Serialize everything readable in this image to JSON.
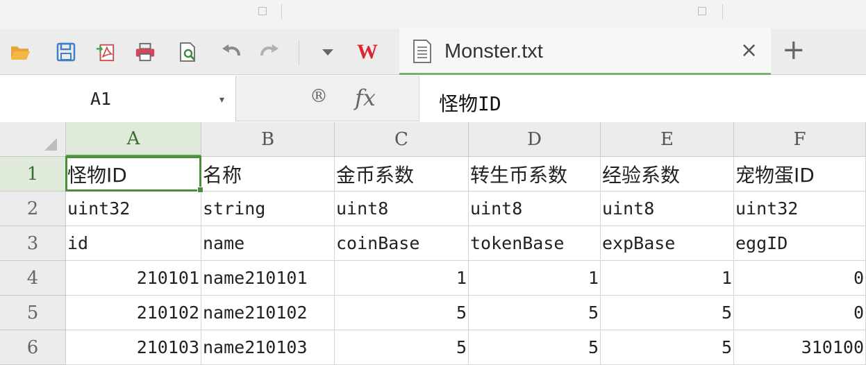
{
  "app": {
    "accent_color": "#5f9d4f"
  },
  "toolbar": {
    "icons": [
      "open-folder-icon",
      "save-icon",
      "export-pdf-icon",
      "print-icon",
      "print-preview-icon",
      "undo-icon",
      "redo-icon",
      "dropdown-arrow-icon",
      "wps-logo-icon"
    ],
    "wps_logo": "W"
  },
  "tab": {
    "title": "Monster.txt",
    "close": "×",
    "new_tab": "+"
  },
  "formula_bar": {
    "name_box": "A1",
    "name_box_arrow": "▾",
    "zoom_icon": "®",
    "fx_label": "fx",
    "value": "怪物ID"
  },
  "grid": {
    "columns": [
      "A",
      "B",
      "C",
      "D",
      "E",
      "F"
    ],
    "rows": [
      "1",
      "2",
      "3",
      "4",
      "5",
      "6"
    ],
    "active_cell": "A1",
    "cells": [
      [
        "怪物ID",
        "名称",
        "金币系数",
        "转生币系数",
        "经验系数",
        "宠物蛋ID"
      ],
      [
        "uint32",
        "string",
        "uint8",
        "uint8",
        "uint8",
        "uint32"
      ],
      [
        "id",
        "name",
        "coinBase",
        "tokenBase",
        "expBase",
        "eggID"
      ],
      [
        "210101",
        "name210101",
        "1",
        "1",
        "1",
        "0"
      ],
      [
        "210102",
        "name210102",
        "5",
        "5",
        "5",
        "0"
      ],
      [
        "210103",
        "name210103",
        "5",
        "5",
        "5",
        "310100"
      ]
    ]
  }
}
